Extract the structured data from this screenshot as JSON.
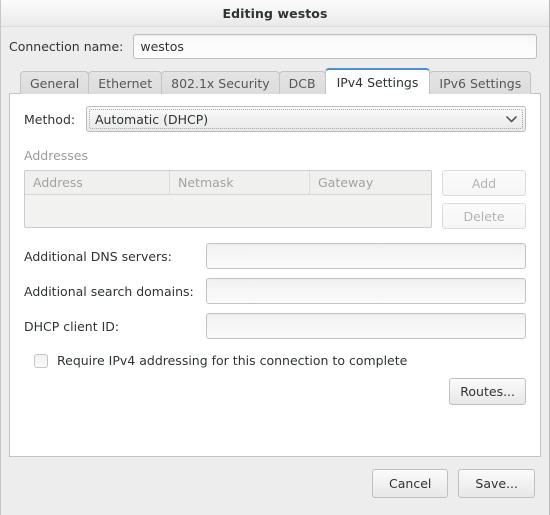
{
  "window": {
    "title": "Editing westos"
  },
  "connection": {
    "label": "Connection name:",
    "value": "westos",
    "placeholder": ""
  },
  "tabs": [
    {
      "label": "General",
      "active": false
    },
    {
      "label": "Ethernet",
      "active": false
    },
    {
      "label": "802.1x Security",
      "active": false
    },
    {
      "label": "DCB",
      "active": false
    },
    {
      "label": "IPv4 Settings",
      "active": true
    },
    {
      "label": "IPv6 Settings",
      "active": false
    }
  ],
  "ipv4": {
    "method": {
      "label": "Method:",
      "value": "Automatic (DHCP)",
      "chevron": "chevron-down-icon"
    },
    "addresses": {
      "section_label": "Addresses",
      "columns": [
        "Address",
        "Netmask",
        "Gateway"
      ],
      "rows": [],
      "add_label": "Add",
      "delete_label": "Delete"
    },
    "fields": [
      {
        "label": "Additional DNS servers:",
        "value": "",
        "placeholder": ""
      },
      {
        "label": "Additional search domains:",
        "value": "",
        "placeholder": ""
      },
      {
        "label": "DHCP client ID:",
        "value": "",
        "placeholder": ""
      }
    ],
    "require_ipv4": {
      "label": "Require IPv4 addressing for this connection to complete",
      "checked": false
    },
    "routes_label": "Routes..."
  },
  "actions": {
    "cancel_label": "Cancel",
    "save_label": "Save..."
  },
  "colors": {
    "accent": "#4a90d9",
    "window_bg": "#ededed",
    "panel_bg": "#ffffff",
    "text": "#2e3436",
    "muted_text": "#9a9a9a",
    "disabled_text": "#b3b3b3"
  }
}
